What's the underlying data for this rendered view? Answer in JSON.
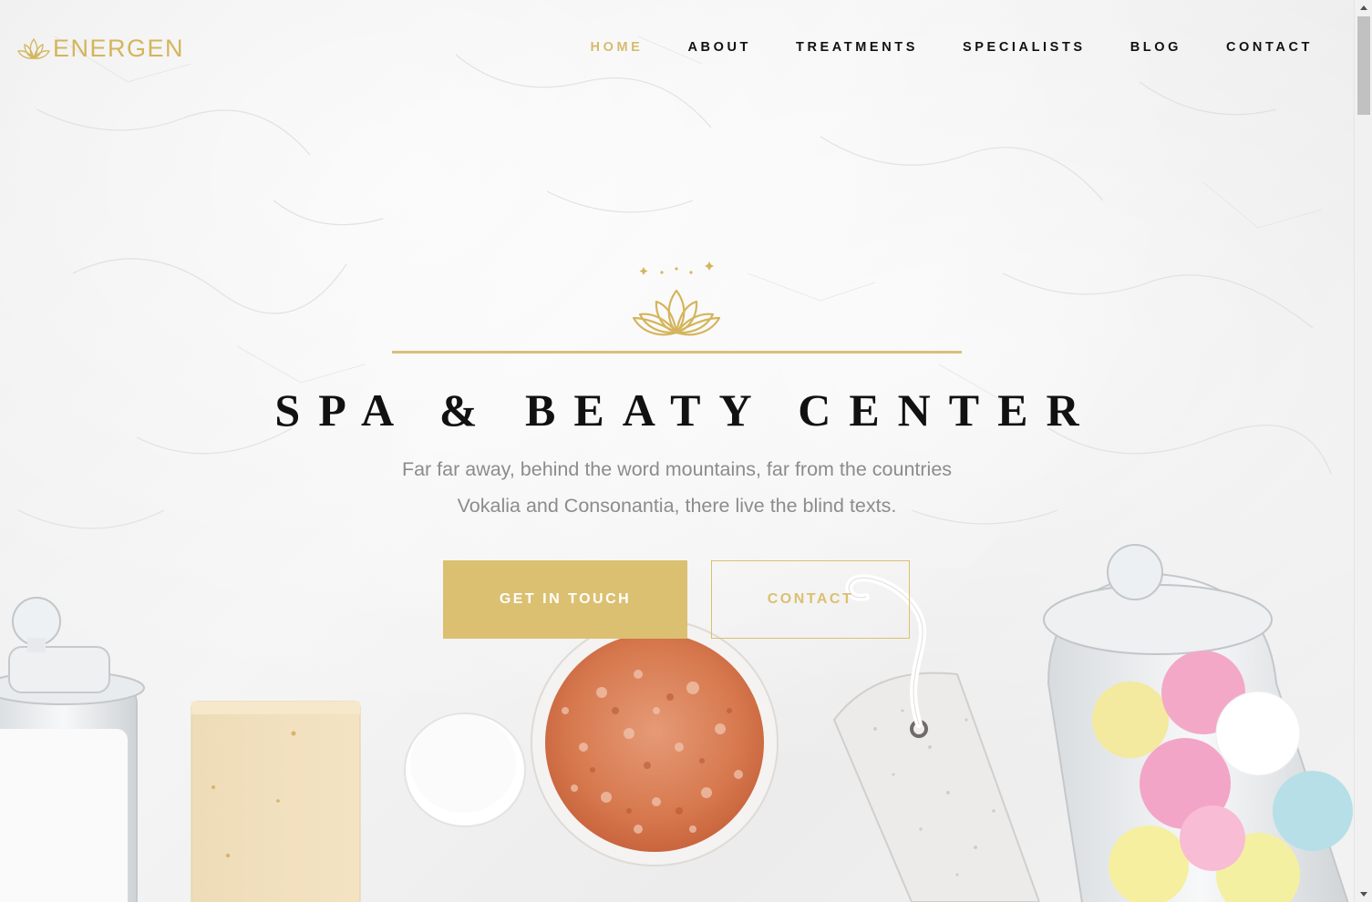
{
  "brand": {
    "name": "ENERGEN",
    "icon": "lotus-icon",
    "color": "#d4b55c"
  },
  "nav": {
    "items": [
      {
        "label": "HOME",
        "active": true
      },
      {
        "label": "ABOUT",
        "active": false
      },
      {
        "label": "TREATMENTS",
        "active": false
      },
      {
        "label": "SPECIALISTS",
        "active": false
      },
      {
        "label": "BLOG",
        "active": false
      },
      {
        "label": "CONTACT",
        "active": false
      }
    ],
    "active_color": "#d6bb6e"
  },
  "hero": {
    "icon": "lotus-icon",
    "title": "SPA & BEATY CENTER",
    "subtitle_line1": "Far far away, behind the word mountains, far from the countries",
    "subtitle_line2": "Vokalia and Consonantia, there live the blind texts.",
    "primary_button": "GET IN TOUCH",
    "secondary_button": "CONTACT",
    "accent_color": "#dbc071"
  }
}
